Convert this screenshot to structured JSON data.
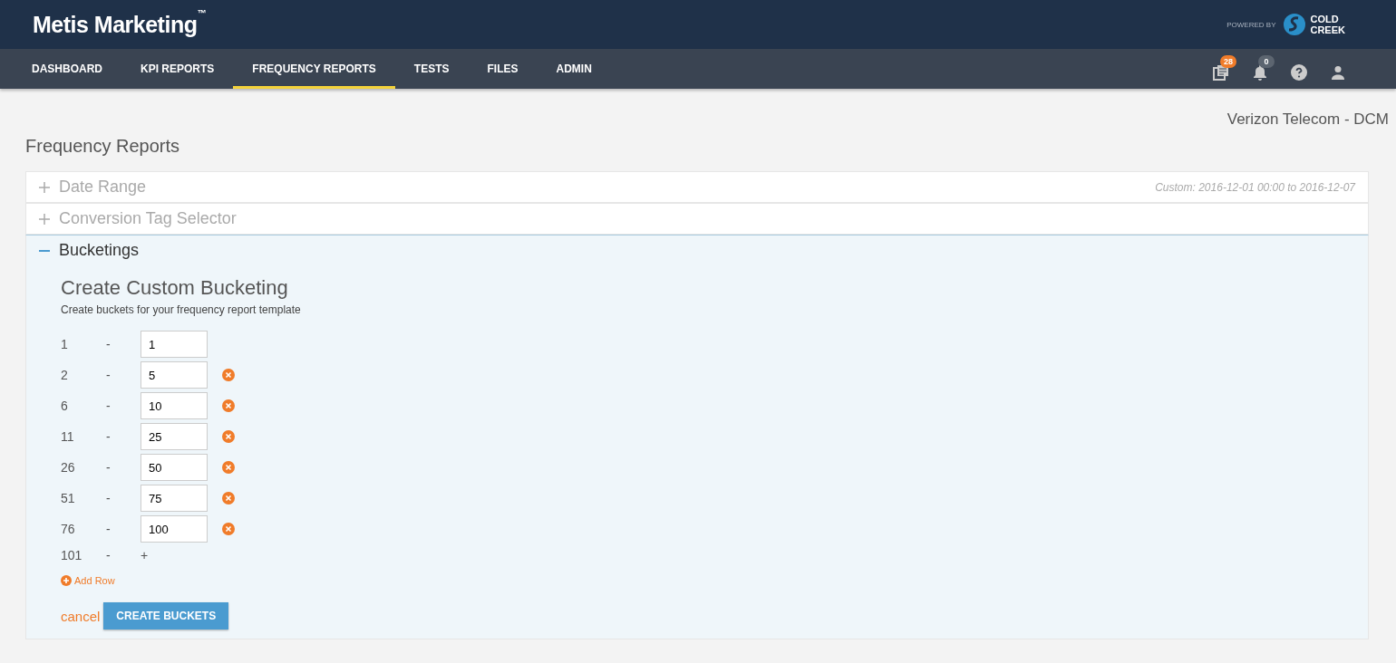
{
  "header": {
    "logo": "Metis Marketing$^{™}$",
    "powered_by": "POWERED BY",
    "partner_lines": [
      "COLD",
      "CREEK"
    ]
  },
  "nav": {
    "tabs": [
      {
        "label": "DASHBOARD",
        "selected": false
      },
      {
        "label": "KPI REPORTS",
        "selected": false
      },
      {
        "label": "FREQUENCY REPORTS",
        "selected": true
      },
      {
        "label": "TESTS",
        "selected": false
      },
      {
        "label": "FILES",
        "selected": false
      },
      {
        "label": "ADMIN",
        "selected": false
      }
    ],
    "icons": [
      {
        "kind": "reports",
        "badge": "28",
        "color": "#f07c2a"
      },
      {
        "kind": "bell",
        "badge": "0",
        "color": "#5c6570"
      },
      {
        "kind": "help"
      },
      {
        "kind": "user"
      }
    ]
  },
  "page": {
    "title": "Frequency Reports",
    "account": "Verizon Telecom - DCM"
  },
  "sections": [
    {
      "title": "Date Range",
      "expanded": false,
      "summary": "Custom: 2016-12-01 00:00 to 2016-12-07"
    },
    {
      "title": "Conversion Tag Selector",
      "expanded": false
    },
    {
      "title": "Bucketings",
      "expanded": true
    }
  ],
  "bucketing": {
    "heading": "Create Custom Bucketing",
    "subtitle": "Create buckets for your frequency report template",
    "rows": [
      {
        "start": "1",
        "separator": "-",
        "value": "1",
        "removable": false
      },
      {
        "start": "2",
        "separator": "-",
        "value": "5",
        "removable": true
      },
      {
        "start": "6",
        "separator": "-",
        "value": "10",
        "removable": true
      },
      {
        "start": "11",
        "separator": "-",
        "value": "25",
        "removable": true
      },
      {
        "start": "26",
        "separator": "-",
        "value": "50",
        "removable": true
      },
      {
        "start": "51",
        "separator": "-",
        "value": "75",
        "removable": true
      },
      {
        "start": "76",
        "separator": "-",
        "value": "100",
        "removable": true
      }
    ],
    "last_row": {
      "start": "101",
      "separator": "-",
      "end": "+"
    },
    "add_row": "Add Row",
    "cancel": "cancel",
    "submit": "CREATE BUCKETS"
  }
}
